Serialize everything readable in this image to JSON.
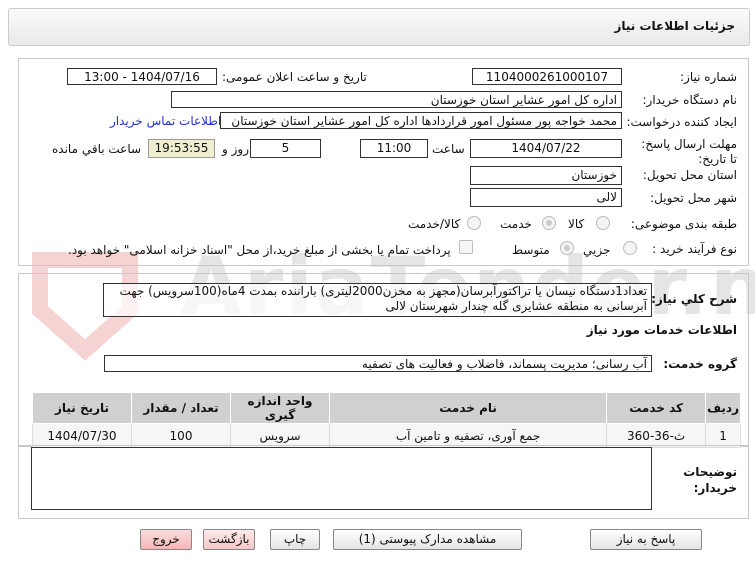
{
  "header": {
    "title": "جزئیات اطلاعات نیاز"
  },
  "form": {
    "need_number_label": "شماره نیاز:",
    "need_number": "1104000261000107",
    "announce_label": "تاریخ و ساعت اعلان عمومی:",
    "announce_value": "1404/07/16 - 13:00",
    "buyer_label": "نام دستگاه خریدار:",
    "buyer": "اداره کل امور عشایر استان خوزستان",
    "creator_label": "ایجاد کننده درخواست:",
    "creator": "محمد خواجه پور مسئول امور قراردادها اداره کل امور عشایر استان خوزستان",
    "contact_link": "اطلاعات تماس خریدار",
    "deadline_label": "مهلت ارسال پاسخ: تا تاریخ:",
    "deadline_date": "1404/07/22",
    "time_label": "ساعت",
    "deadline_time": "11:00",
    "days": "5",
    "days_label": "روز و",
    "remaining": "19:53:55",
    "remaining_label": "ساعت باقي مانده",
    "province_label": "استان محل تحویل:",
    "province": "خوزستان",
    "city_label": "شهر محل تحویل:",
    "city": "لالی",
    "category_label": "طبقه بندی موضوعی:",
    "category_options": [
      "کالا",
      "خدمت",
      "کالا/خدمت"
    ],
    "category_selected": "خدمت",
    "process_label": "نوع فرآیند خرید :",
    "process_options": [
      "جزیي",
      "متوسط"
    ],
    "process_selected": "متوسط",
    "payment_note": "پرداخت تمام یا بخشی از مبلغ خرید،از محل \"اسناد خزانه اسلامی\" خواهد بود."
  },
  "details": {
    "desc_label": "شرح کلي نیاز:",
    "desc": "تعداد1دستگاه نیسان یا تراکتورآبرسان(مجهز به مخزن2000لیتری) باراننده بمدت 4ماه(100سرویس) جهت آبرسانی به منطقه عشایری گله چندار شهرستان لالی",
    "services_title": "اطلاعات خدمات مورد نیاز",
    "group_label": "گروه خدمت:",
    "group": "آب رسانی؛ مدیریت پسماند، فاضلاب و فعالیت های تصفیه",
    "table": {
      "headers": [
        "ردیف",
        "کد خدمت",
        "نام خدمت",
        "واحد اندازه گیری",
        "تعداد / مقدار",
        "تاریخ نیاز"
      ],
      "rows": [
        [
          "1",
          "ث-36-360",
          "جمع آوری، تصفیه و تامین آب",
          "سرویس",
          "100",
          "1404/07/30"
        ]
      ]
    },
    "buyer_notes_label": "توضیحات خریدار:",
    "buyer_notes": ""
  },
  "buttons": {
    "reply": "پاسخ به نیاز",
    "attachments": "مشاهده مدارک پیوستی (1)",
    "print": "چاپ",
    "back": "بازگشت",
    "exit": "خروج"
  },
  "watermark": "AriaTender.net"
}
